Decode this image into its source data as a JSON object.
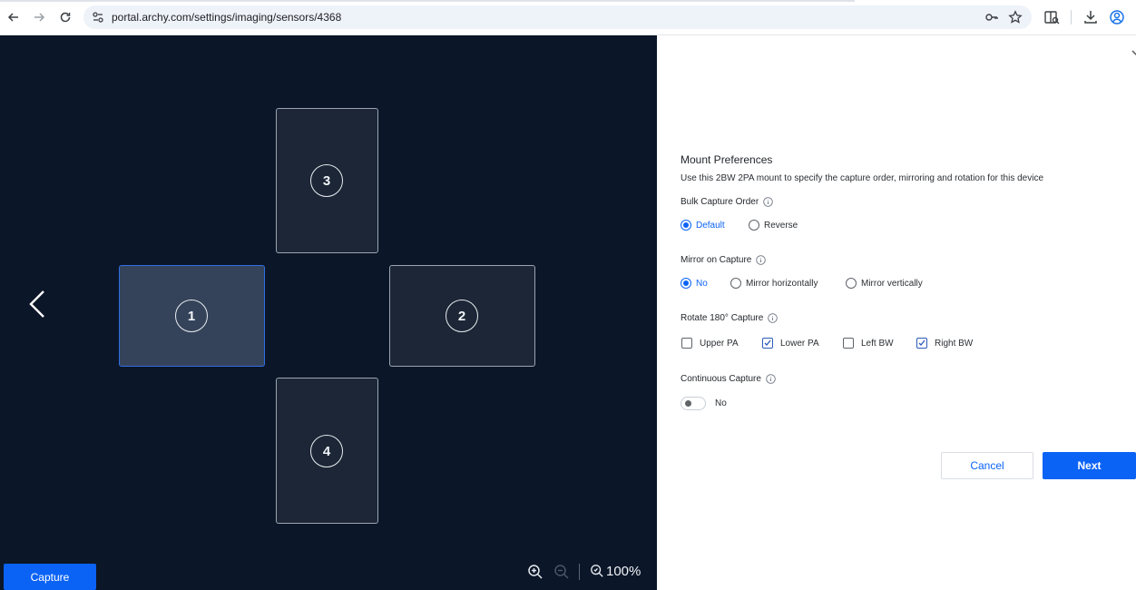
{
  "browser": {
    "url": "portal.archy.com/settings/imaging/sensors/4368",
    "icons": [
      "back-icon",
      "forward-icon",
      "reload-icon",
      "site-settings-icon",
      "password-key-icon",
      "bookmark-star-icon",
      "reading-mode-icon",
      "download-icon",
      "profile-icon"
    ]
  },
  "viewer": {
    "slots": [
      {
        "number": "1",
        "active": true
      },
      {
        "number": "2",
        "active": false
      },
      {
        "number": "3",
        "active": false
      },
      {
        "number": "4",
        "active": false
      }
    ],
    "capture_label": "Capture",
    "zoom_level": "100%"
  },
  "panel": {
    "title": "Mount Preferences",
    "subtitle": "Use this 2BW 2PA mount to specify the capture order, mirroring and rotation for this device",
    "bulk_capture": {
      "label": "Bulk Capture Order",
      "options": [
        "Default",
        "Reverse"
      ],
      "selected": "Default"
    },
    "mirror": {
      "label": "Mirror on Capture",
      "options": [
        "No",
        "Mirror horizontally",
        "Mirror vertically"
      ],
      "selected": "No"
    },
    "rotate": {
      "label": "Rotate 180° Capture",
      "options": [
        {
          "label": "Upper PA",
          "checked": false
        },
        {
          "label": "Lower PA",
          "checked": true
        },
        {
          "label": "Left BW",
          "checked": false
        },
        {
          "label": "Right BW",
          "checked": true
        }
      ]
    },
    "continuous": {
      "label": "Continuous Capture",
      "value": "No"
    },
    "cancel_label": "Cancel",
    "next_label": "Next"
  },
  "colors": {
    "accent": "#0b63f6",
    "viewer_bg": "#0b1628",
    "slot_active_border": "#2f6fe4"
  }
}
